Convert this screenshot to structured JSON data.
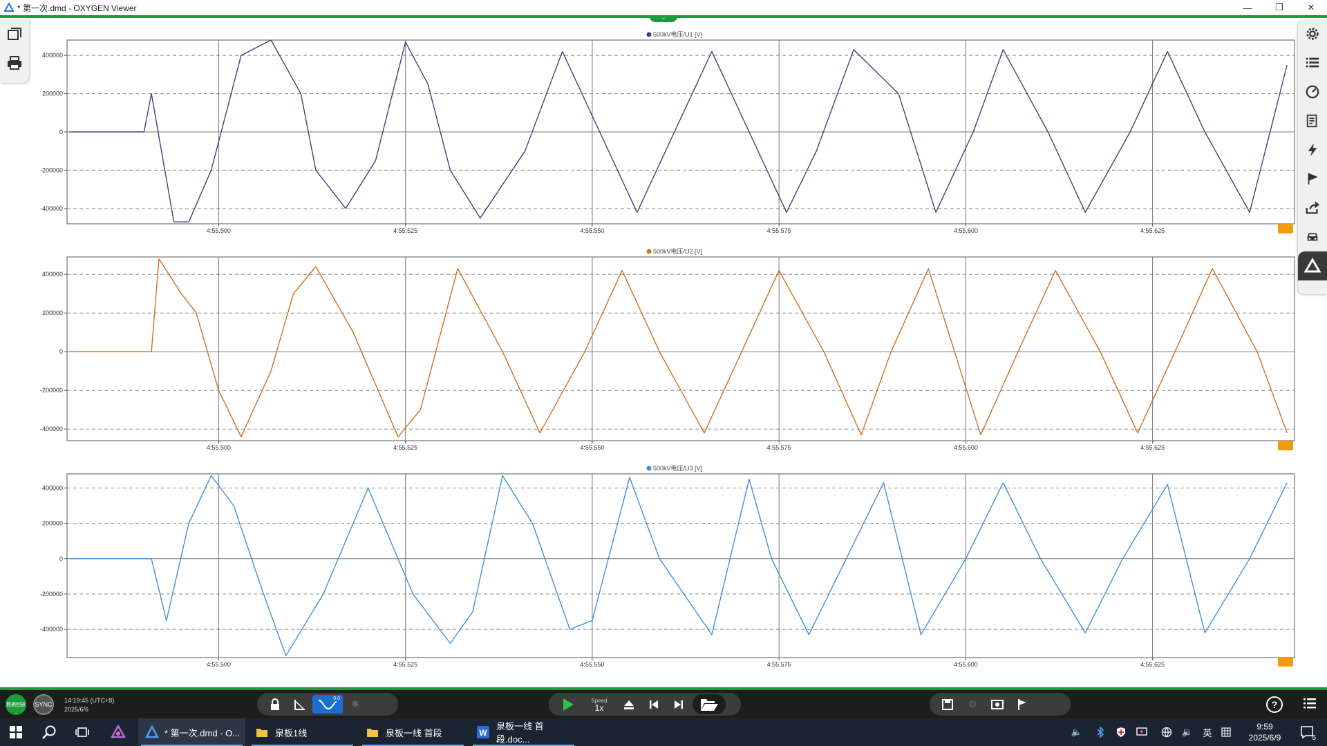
{
  "window": {
    "title": "* 第一次.dmd - OXYGEN Viewer"
  },
  "charts": [
    {
      "title": "500kV电压/U1 [V]",
      "color": "#4b3a7e",
      "y_ticks": [
        "400000",
        "200000",
        "0",
        "-200000",
        "-400000"
      ],
      "x_ticks": [
        "4:55.500",
        "4:55.525",
        "4:55.550",
        "4:55.575",
        "4:55.600",
        "4:55.625"
      ]
    },
    {
      "title": "500kV电压/U2 [V]",
      "color": "#d26f1e",
      "y_ticks": [
        "400000",
        "200000",
        "0",
        "-200000",
        "-400000"
      ],
      "x_ticks": [
        "4:55.500",
        "4:55.525",
        "4:55.550",
        "4:55.575",
        "4:55.600",
        "4:55.625"
      ]
    },
    {
      "title": "500kV电压/U3 [V]",
      "color": "#3f8fe0",
      "y_ticks": [
        "400000",
        "200000",
        "0",
        "-200000",
        "-400000"
      ],
      "x_ticks": [
        "4:55.500",
        "4:55.525",
        "4:55.550",
        "4:55.575",
        "4:55.600",
        "4:55.625"
      ]
    }
  ],
  "chart_data": [
    {
      "type": "line",
      "title": "500kV电压/U1 [V]",
      "ylim": [
        -480000,
        480000
      ],
      "xlim": [
        "4:55.4797",
        "4:55.6440"
      ],
      "series": [
        {
          "name": "500kV电压/U1 [V]",
          "x": [
            "4:55.480",
            "4:55.490",
            "4:55.491",
            "4:55.494",
            "4:55.496",
            "4:55.499",
            "4:55.503",
            "4:55.507",
            "4:55.511",
            "4:55.513",
            "4:55.517",
            "4:55.521",
            "4:55.525",
            "4:55.528",
            "4:55.531",
            "4:55.535",
            "4:55.541",
            "4:55.546",
            "4:55.551",
            "4:55.556",
            "4:55.561",
            "4:55.566",
            "4:55.571",
            "4:55.576",
            "4:55.580",
            "4:55.585",
            "4:55.591",
            "4:55.596",
            "4:55.601",
            "4:55.605",
            "4:55.611",
            "4:55.616",
            "4:55.622",
            "4:55.627",
            "4:55.632",
            "4:55.638",
            "4:55.643"
          ],
          "values": [
            0,
            0,
            200000,
            -470000,
            -470000,
            -200000,
            400000,
            480000,
            200000,
            -200000,
            -400000,
            -150000,
            470000,
            250000,
            -200000,
            -450000,
            -100000,
            420000,
            0,
            -420000,
            0,
            420000,
            0,
            -420000,
            -100000,
            430000,
            200000,
            -420000,
            0,
            430000,
            0,
            -420000,
            0,
            420000,
            0,
            -420000,
            350000
          ]
        }
      ]
    },
    {
      "type": "line",
      "title": "500kV电压/U2 [V]",
      "ylim": [
        -460000,
        490000
      ],
      "xlim": [
        "4:55.4797",
        "4:55.6440"
      ],
      "series": [
        {
          "name": "500kV电压/U2 [V]",
          "x": [
            "4:55.480",
            "4:55.491",
            "4:55.492",
            "4:55.495",
            "4:55.497",
            "4:55.500",
            "4:55.503",
            "4:55.507",
            "4:55.510",
            "4:55.513",
            "4:55.518",
            "4:55.524",
            "4:55.527",
            "4:55.532",
            "4:55.538",
            "4:55.543",
            "4:55.549",
            "4:55.554",
            "4:55.559",
            "4:55.565",
            "4:55.570",
            "4:55.575",
            "4:55.581",
            "4:55.586",
            "4:55.590",
            "4:55.595",
            "4:55.602",
            "4:55.607",
            "4:55.612",
            "4:55.618",
            "4:55.623",
            "4:55.628",
            "4:55.633",
            "4:55.639",
            "4:55.643"
          ],
          "values": [
            0,
            0,
            480000,
            300000,
            200000,
            -200000,
            -440000,
            -100000,
            300000,
            440000,
            100000,
            -440000,
            -300000,
            430000,
            0,
            -420000,
            0,
            420000,
            0,
            -420000,
            0,
            420000,
            0,
            -430000,
            0,
            430000,
            -430000,
            0,
            420000,
            0,
            -420000,
            0,
            430000,
            0,
            -420000
          ]
        }
      ]
    },
    {
      "type": "line",
      "title": "500kV电压/U3 [V]",
      "ylim": [
        -560000,
        480000
      ],
      "xlim": [
        "4:55.4797",
        "4:55.6440"
      ],
      "series": [
        {
          "name": "500kV电压/U3 [V]",
          "x": [
            "4:55.480",
            "4:55.491",
            "4:55.493",
            "4:55.496",
            "4:55.499",
            "4:55.502",
            "4:55.506",
            "4:55.509",
            "4:55.514",
            "4:55.520",
            "4:55.526",
            "4:55.531",
            "4:55.534",
            "4:55.538",
            "4:55.542",
            "4:55.547",
            "4:55.550",
            "4:55.555",
            "4:55.559",
            "4:55.566",
            "4:55.571",
            "4:55.574",
            "4:55.579",
            "4:55.584",
            "4:55.589",
            "4:55.594",
            "4:55.600",
            "4:55.605",
            "4:55.610",
            "4:55.616",
            "4:55.621",
            "4:55.627",
            "4:55.632",
            "4:55.638",
            "4:55.643"
          ],
          "values": [
            0,
            0,
            -350000,
            200000,
            470000,
            300000,
            -200000,
            -550000,
            -200000,
            400000,
            -200000,
            -480000,
            -300000,
            470000,
            200000,
            -400000,
            -350000,
            460000,
            0,
            -430000,
            450000,
            0,
            -430000,
            0,
            430000,
            -430000,
            0,
            430000,
            0,
            -420000,
            0,
            420000,
            -420000,
            0,
            430000
          ]
        }
      ]
    }
  ],
  "left_toolbar": [
    {
      "icon": "layers-icon"
    },
    {
      "icon": "printer-icon"
    }
  ],
  "right_toolbar": [
    {
      "icon": "gear-icon"
    },
    {
      "icon": "list-icon"
    },
    {
      "icon": "gauge-icon"
    },
    {
      "icon": "report-icon"
    },
    {
      "icon": "lightning-icon"
    },
    {
      "icon": "flag-icon"
    },
    {
      "icon": "export-icon"
    },
    {
      "icon": "car-icon"
    },
    {
      "icon": "oxygen-logo-icon"
    }
  ],
  "statusbar": {
    "status_label": "数据回放",
    "sync_label": "SYNC",
    "time": "14:19:45 (UTC+8)",
    "date": "2025/6/6",
    "speed_label": "Speed",
    "speed_value": "1x",
    "cursor_badge": "0.0"
  },
  "taskbar": {
    "apps": [
      {
        "label": "* 第一次.dmd - O...",
        "icon": "oxygen-app-icon"
      },
      {
        "label": "泉板1线",
        "icon": "folder-icon"
      },
      {
        "label": "泉板一线  首段",
        "icon": "folder-icon"
      },
      {
        "label": "泉板一线 首段.doc...",
        "icon": "word-icon"
      }
    ],
    "ime": "英",
    "clock_time": "9:59",
    "clock_date": "2025/6/9",
    "notification_count": "5"
  }
}
